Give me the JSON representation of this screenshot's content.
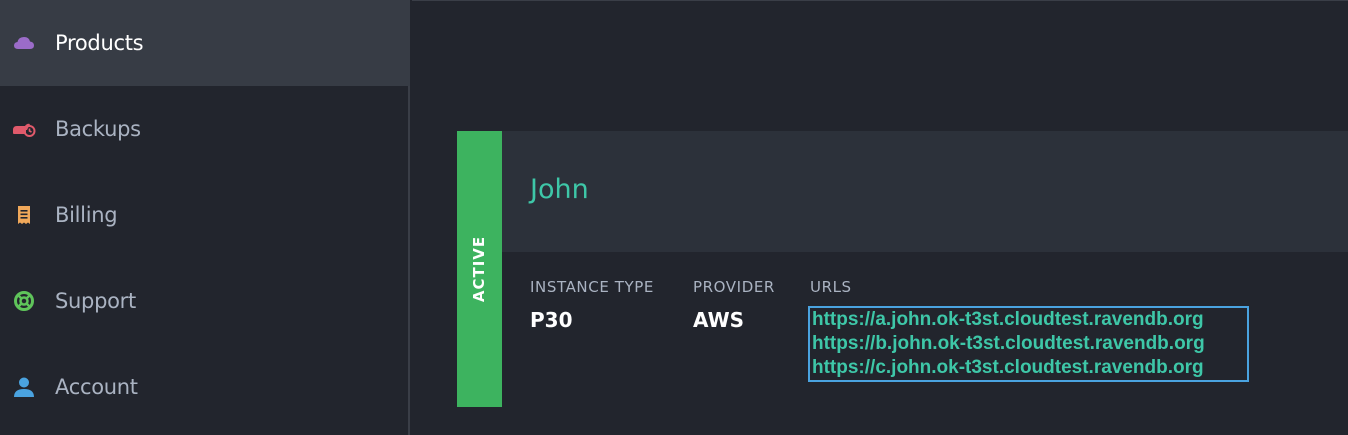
{
  "sidebar": {
    "items": [
      {
        "label": "Products",
        "icon": "cloud-icon",
        "color": "#9b6cc9",
        "active": true
      },
      {
        "label": "Backups",
        "icon": "backup-icon",
        "color": "#e05a6b",
        "active": false
      },
      {
        "label": "Billing",
        "icon": "receipt-icon",
        "color": "#f0a85a",
        "active": false
      },
      {
        "label": "Support",
        "icon": "lifebuoy-icon",
        "color": "#5fc45a",
        "active": false
      },
      {
        "label": "Account",
        "icon": "user-icon",
        "color": "#4aa3e0",
        "active": false
      }
    ]
  },
  "product": {
    "status": "ACTIVE",
    "status_color": "#3db35f",
    "name": "John",
    "instance_type_label": "INSTANCE TYPE",
    "instance_type": "P30",
    "provider_label": "PROVIDER",
    "provider": "AWS",
    "urls_label": "URLS",
    "urls": [
      "https://a.john.ok-t3st.cloudtest.ravendb.org",
      "https://b.john.ok-t3st.cloudtest.ravendb.org",
      "https://c.john.ok-t3st.cloudtest.ravendb.org"
    ]
  }
}
